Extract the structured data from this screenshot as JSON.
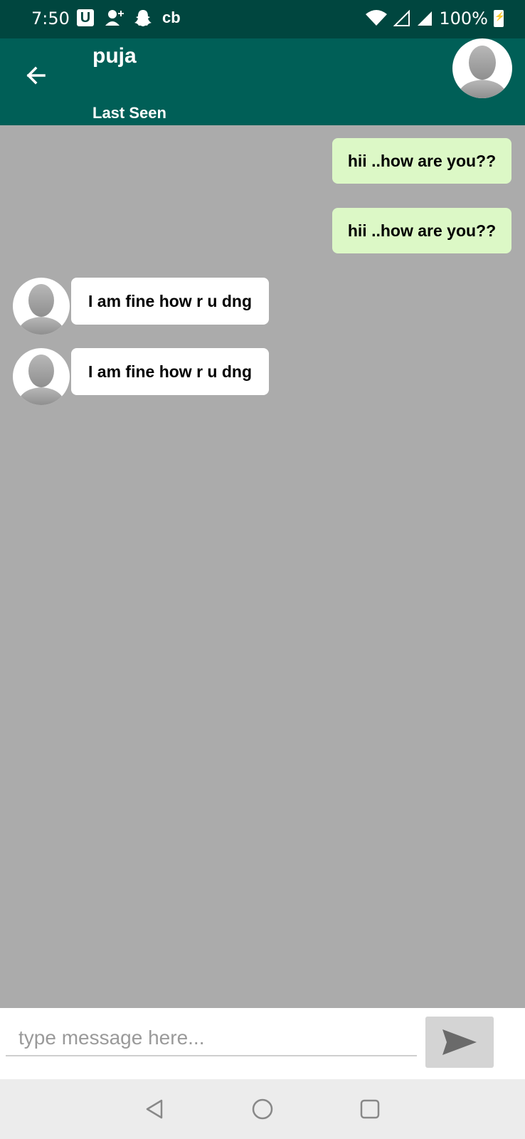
{
  "status_bar": {
    "time": "7:50",
    "u_label": "U",
    "cb_label": "cb",
    "battery": "100%"
  },
  "header": {
    "contact_name": "puja",
    "status": "Last Seen"
  },
  "messages": [
    {
      "direction": "outgoing",
      "text": "hii ..how are you??"
    },
    {
      "direction": "outgoing",
      "text": "hii ..how are you??"
    },
    {
      "direction": "incoming",
      "text": "I am fine how r u dng"
    },
    {
      "direction": "incoming",
      "text": "I am fine how r u dng"
    }
  ],
  "composer": {
    "placeholder": "type message here..."
  },
  "colors": {
    "status_bar": "#00463f",
    "app_bar": "#005f57",
    "chat_background": "#ababab",
    "outgoing_bubble": "#dcf8c6",
    "incoming_bubble": "#ffffff"
  },
  "icons": [
    "back-arrow-icon",
    "avatar-icon",
    "send-icon",
    "nav-back-icon",
    "nav-home-icon",
    "nav-recents-icon",
    "wifi-icon",
    "signal-icon",
    "battery-icon"
  ]
}
